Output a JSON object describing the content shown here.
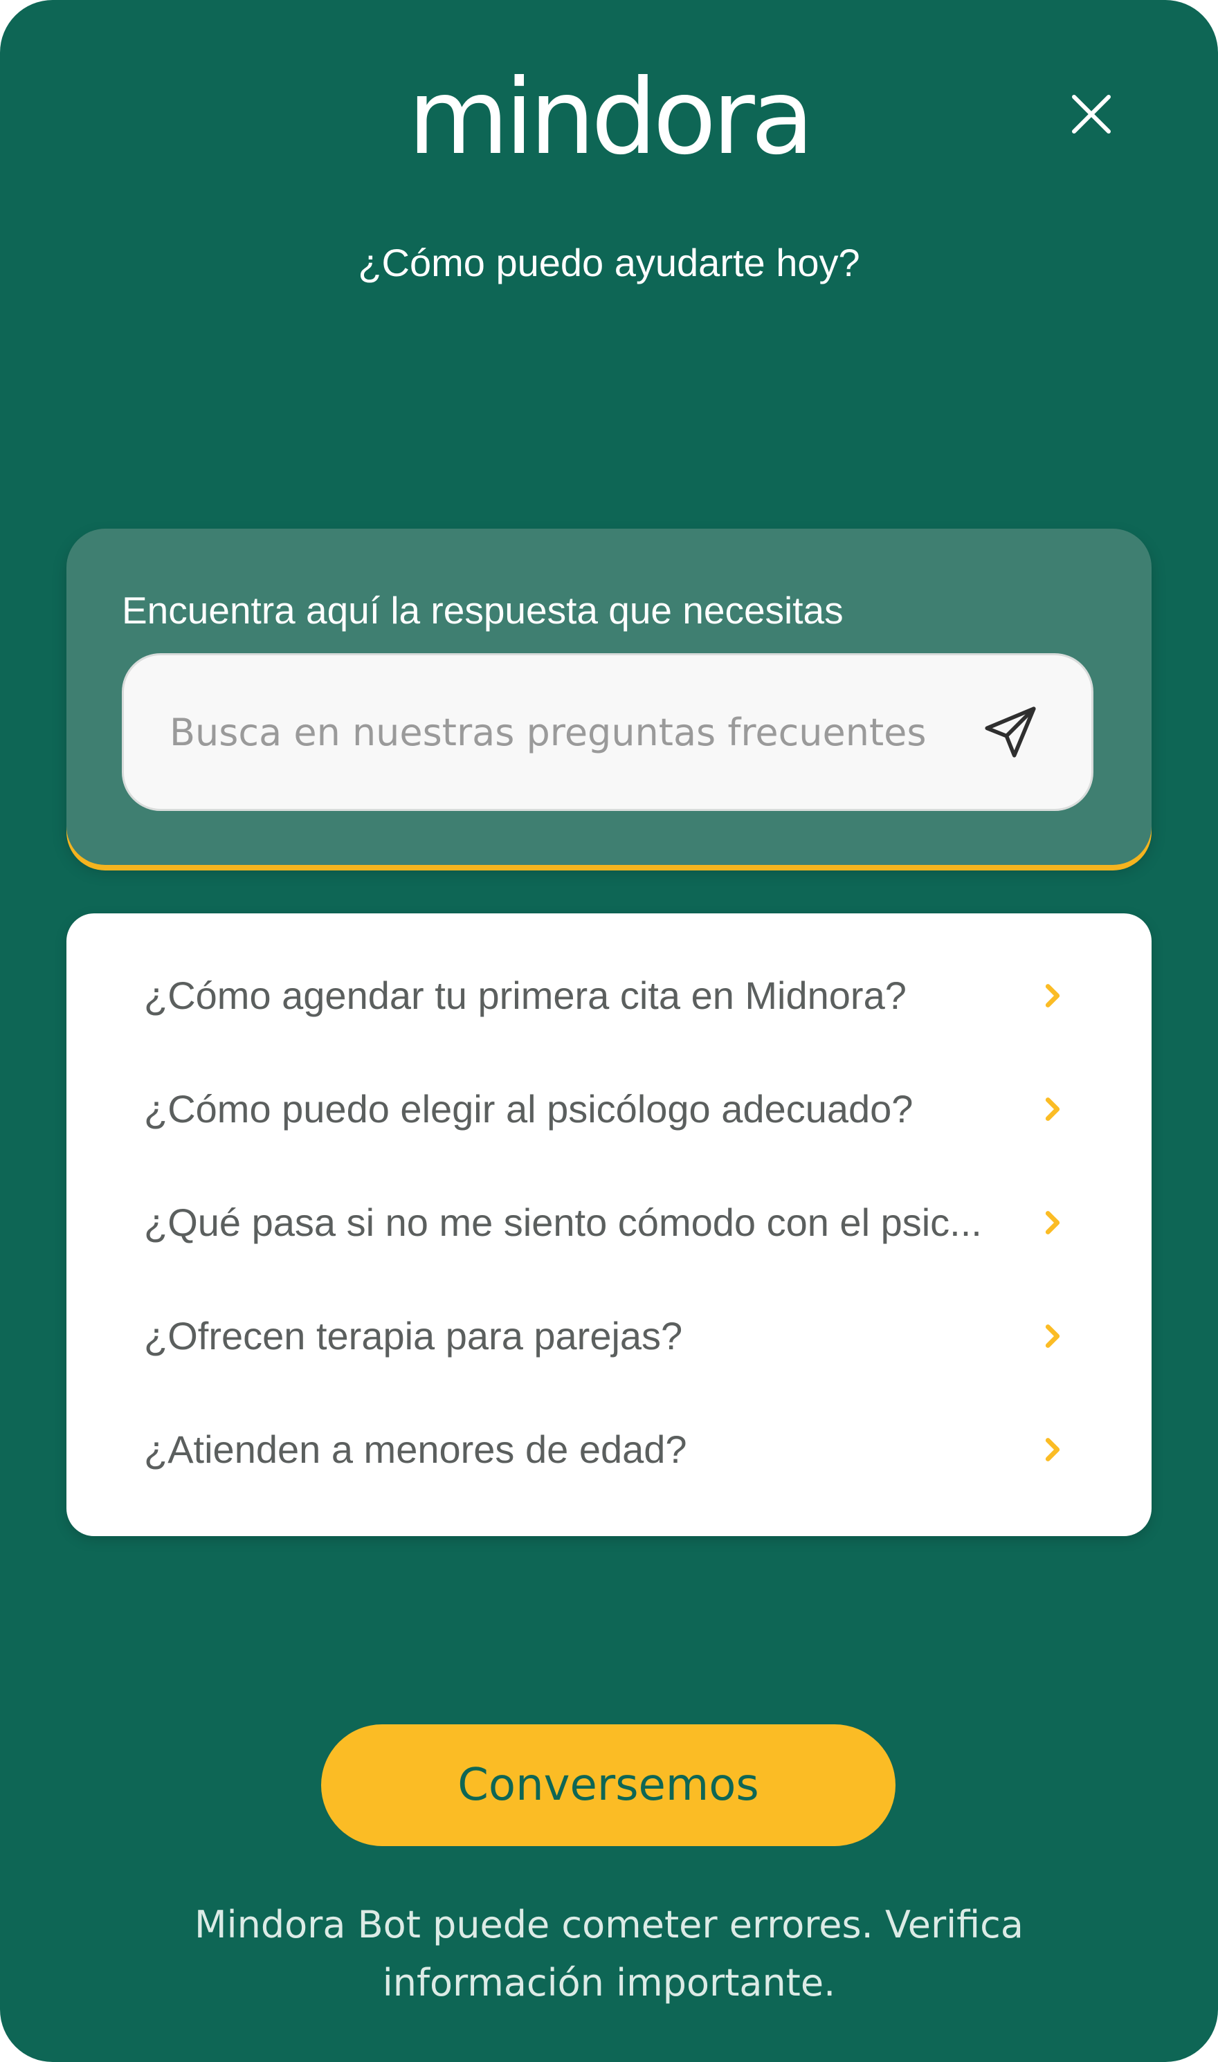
{
  "header": {
    "logo_text": "mindora",
    "close_icon": "close-icon",
    "greeting": "¿Cómo puedo ayudarte hoy?"
  },
  "search": {
    "title": "Encuentra aquí la respuesta que necesitas",
    "placeholder": "Busca en nuestras preguntas frecuentes",
    "value": "",
    "send_icon": "send-icon"
  },
  "faq": {
    "items": [
      {
        "label": "¿Cómo agendar tu primera cita en Midnora?"
      },
      {
        "label": "¿Cómo puedo elegir al psicólogo adecuado?"
      },
      {
        "label": "¿Qué pasa si no me siento cómodo con el psic..."
      },
      {
        "label": "¿Ofrecen terapia para parejas?"
      },
      {
        "label": "¿Atienden a menores de edad?"
      }
    ],
    "chevron_icon": "chevron-right-icon"
  },
  "cta": {
    "label": "Conversemos"
  },
  "footer": {
    "disclaimer": "Mindora Bot puede cometer errores. Verifica información importante."
  },
  "colors": {
    "background": "#0e6655",
    "card_translucent": "#3f7f71",
    "accent_yellow": "#fbbc25",
    "faq_text": "#5b5f5e"
  }
}
